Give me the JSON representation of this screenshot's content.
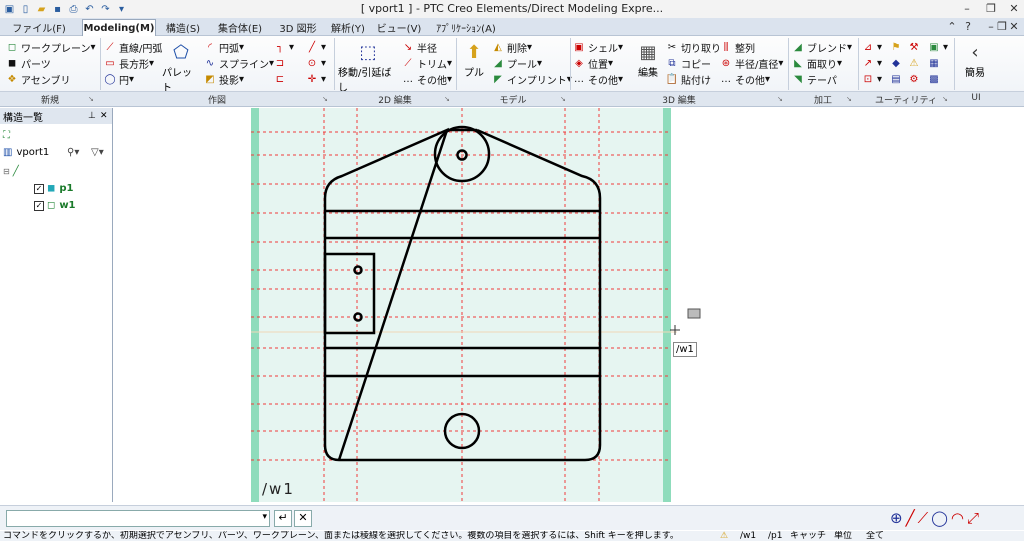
{
  "title": "[ vport1 ] - PTC Creo Elements/Direct Modeling Expre...",
  "tabs": [
    {
      "label": "ファイル(F)"
    },
    {
      "label": "Modeling(M)"
    },
    {
      "label": "構造(S)"
    },
    {
      "label": "集合体(E)"
    },
    {
      "label": "3D 図形"
    },
    {
      "label": "解析(Y)"
    },
    {
      "label": "ビュー(V)"
    },
    {
      "label": "ｱﾌﾟﾘｹｰｼｮﾝ(A)"
    }
  ],
  "ribbon": {
    "shinki": {
      "workplane": "ワークプレーン",
      "parts": "パーツ",
      "assembly": "アセンブリ"
    },
    "sakuzu": {
      "line_arc": "直線/円弧",
      "rectangle": "長方形",
      "circle": "円",
      "palette": "パレット",
      "arc": "円弧",
      "spline": "スプライン",
      "projection": "投影"
    },
    "edit2d": {
      "move_stretch": "移動/引延ばし",
      "radius": "半径",
      "trim": "トリム",
      "other": "その他"
    },
    "model": {
      "pull": "プル",
      "delete": "削除",
      "pool": "プール",
      "imprint": "インプリント"
    },
    "edit3d": {
      "shell": "シェル",
      "position": "位置",
      "other": "その他",
      "edit": "編集",
      "cut": "切り取り",
      "copy": "コピー",
      "paste": "貼付け",
      "align": "整列",
      "radius_dia": "半径/直径",
      "other2": "その他"
    },
    "kakou": {
      "blend": "ブレンド",
      "chamfer": "面取り",
      "taper": "テーパ"
    },
    "ui": {
      "simple": "簡易"
    }
  },
  "groups": {
    "shinki": "新規",
    "sakuzu": "作図",
    "edit2d": "2D 編集",
    "model": "モデル",
    "edit3d": "3D 編集",
    "kakou": "加工",
    "utility": "ユーティリティ",
    "ui": "UI"
  },
  "structure_panel": {
    "title": "構造一覧",
    "viewport_name": "vport1",
    "items": [
      {
        "label": "p1",
        "checked": true
      },
      {
        "label": "w1",
        "checked": true
      }
    ]
  },
  "viewport": {
    "workplane_label": "/w1",
    "tooltip": "/w1"
  },
  "statusbar": {
    "message": "コマンドをクリックするか、初期選択でアセンブリ、パーツ、ワークプレーン、面または稜線を選択してください。複数の項目を選択するには、Shift キーを押します。",
    "w_field": "/w1",
    "p_field": "/p1",
    "catch": "キャッチ",
    "unit": "単位",
    "all": "全て"
  },
  "colors": {
    "grid_red": "#f03c3c",
    "workplane_fill": "#e6f5f1",
    "workplane_edge": "#8fdcbc",
    "tab_active": "#ffffff"
  }
}
